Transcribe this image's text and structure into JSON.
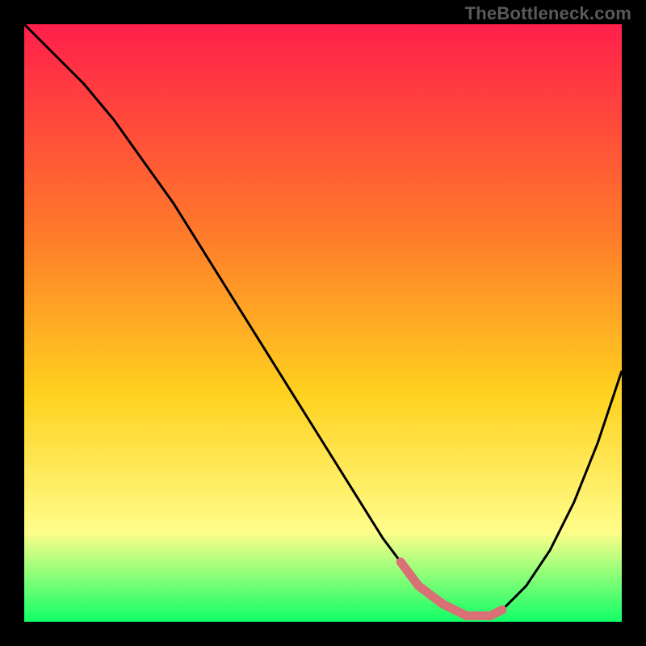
{
  "watermark": "TheBottleneck.com",
  "colors": {
    "gradient_top": "#ff1f4b",
    "gradient_mid1": "#ff7a2a",
    "gradient_mid2": "#ffd21f",
    "gradient_mid3": "#fffd8a",
    "gradient_bottom": "#10ff66",
    "curve": "#000000",
    "highlight": "#d97076",
    "frame": "#000000"
  },
  "chart_data": {
    "type": "line",
    "title": "",
    "xlabel": "",
    "ylabel": "",
    "xlim": [
      0,
      100
    ],
    "ylim": [
      0,
      100
    ],
    "grid": false,
    "series": [
      {
        "name": "bottleneck-curve",
        "x": [
          0,
          5,
          10,
          15,
          20,
          25,
          30,
          35,
          40,
          45,
          50,
          55,
          60,
          63,
          66,
          70,
          74,
          78,
          80,
          84,
          88,
          92,
          96,
          100
        ],
        "y": [
          100,
          95,
          90,
          84,
          77,
          70,
          62,
          54,
          46,
          38,
          30,
          22,
          14,
          10,
          6,
          3,
          1,
          1,
          2,
          6,
          12,
          20,
          30,
          42
        ]
      },
      {
        "name": "optimal-range",
        "x": [
          63,
          66,
          70,
          74,
          78,
          80
        ],
        "y": [
          10,
          6,
          3,
          1,
          1,
          2
        ]
      }
    ],
    "annotations": []
  }
}
